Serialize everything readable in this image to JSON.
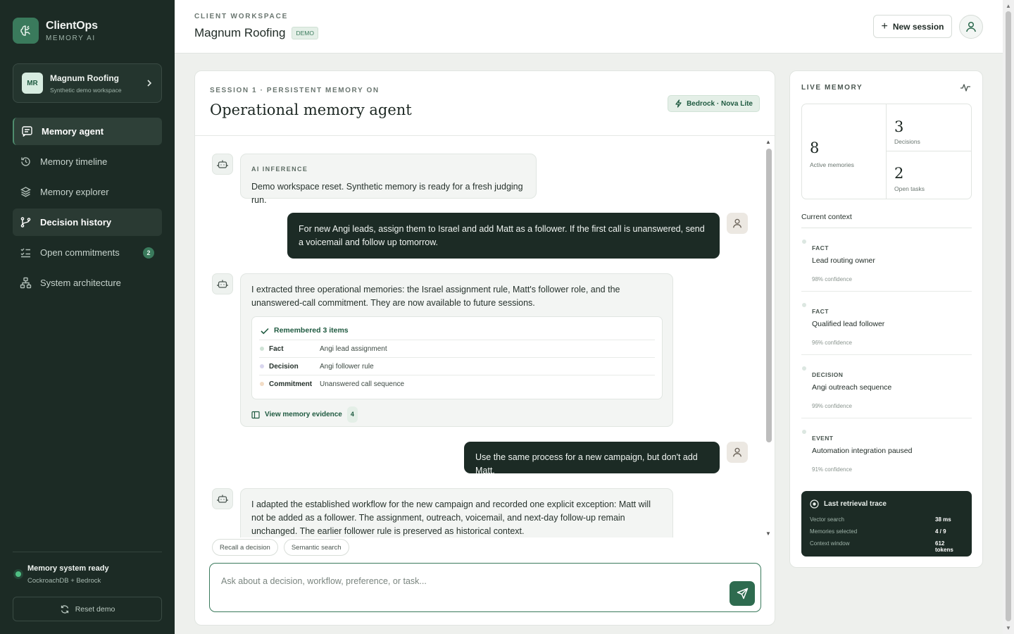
{
  "brand": {
    "name": "ClientOps",
    "sub": "MEMORY AI"
  },
  "workspace": {
    "initials": "MR",
    "name": "Magnum Roofing",
    "sub": "Synthetic demo workspace"
  },
  "nav": [
    {
      "label": "Memory agent",
      "icon": "chat-icon"
    },
    {
      "label": "Memory timeline",
      "icon": "history-icon"
    },
    {
      "label": "Memory explorer",
      "icon": "layers-icon"
    },
    {
      "label": "Decision history",
      "icon": "branch-icon"
    },
    {
      "label": "Open commitments",
      "icon": "checklist-icon",
      "badge": "2"
    },
    {
      "label": "System architecture",
      "icon": "network-icon"
    }
  ],
  "status": {
    "title": "Memory system ready",
    "sub": "CockroachDB + Bedrock",
    "color": "#4fbf83"
  },
  "reset_label": "Reset demo",
  "header": {
    "eyebrow": "CLIENT WORKSPACE",
    "title": "Magnum Roofing",
    "badge": "DEMO",
    "new_session": "New session"
  },
  "chat": {
    "eyebrow": "SESSION 1 · PERSISTENT MEMORY ON",
    "title": "Operational memory agent",
    "model": "Bedrock · Nova Lite",
    "messages": [
      {
        "eyebrow": "AI INFERENCE",
        "text": "Demo workspace reset. Synthetic memory is ready for a fresh judging run."
      },
      {
        "text": "For new Angi leads, assign them to Israel and add Matt as a follower. If the first call is unanswered, send a voicemail and follow up tomorrow."
      },
      {
        "text": "I extracted three operational memories: the Israel assignment rule, Matt's follower role, and the unanswered-call commitment. They are now available to future sessions."
      },
      {
        "text": "Use the same process for a new campaign, but don't add Matt."
      },
      {
        "text": "I adapted the established workflow for the new campaign and recorded one explicit exception: Matt will not be added as a follower. The assignment, outreach, voicemail, and next-day follow-up remain unchanged. The earlier follower rule is preserved as historical context."
      }
    ],
    "remembered": {
      "title": "Remembered 3 items",
      "items": [
        {
          "kind": "Fact",
          "value": "Angi lead assignment",
          "color": "#cfe3d6"
        },
        {
          "kind": "Decision",
          "value": "Angi follower rule",
          "color": "#d9d6ee"
        },
        {
          "kind": "Commitment",
          "value": "Unanswered call sequence",
          "color": "#f2dcc5"
        }
      ],
      "evidence_label": "View memory evidence",
      "evidence_count": "4"
    },
    "chips": [
      "Recall a decision",
      "Semantic search"
    ],
    "composer_placeholder": "Ask about a decision, workflow, preference, or task..."
  },
  "live": {
    "title": "LIVE MEMORY",
    "stats": [
      {
        "value": "8",
        "label": "Active memories"
      },
      {
        "value": "3",
        "label": "Decisions"
      },
      {
        "value": "2",
        "label": "Open tasks"
      }
    ],
    "context_title": "Current context",
    "context": [
      {
        "kind": "FACT",
        "label": "Lead routing owner",
        "confidence": "98% confidence"
      },
      {
        "kind": "FACT",
        "label": "Qualified lead follower",
        "confidence": "96% confidence"
      },
      {
        "kind": "DECISION",
        "label": "Angi outreach sequence",
        "confidence": "99% confidence"
      },
      {
        "kind": "EVENT",
        "label": "Automation integration paused",
        "confidence": "91% confidence"
      }
    ],
    "trace": {
      "title": "Last retrieval trace",
      "rows": [
        {
          "key": "Vector search",
          "value": "38 ms"
        },
        {
          "key": "Memories selected",
          "value": "4 / 9"
        },
        {
          "key": "Context window",
          "value": "612 tokens"
        }
      ]
    }
  },
  "colors": {
    "sidebar": "#1c2b25",
    "accent": "#3a7a5c",
    "user_bubble": "#1c2b25"
  }
}
